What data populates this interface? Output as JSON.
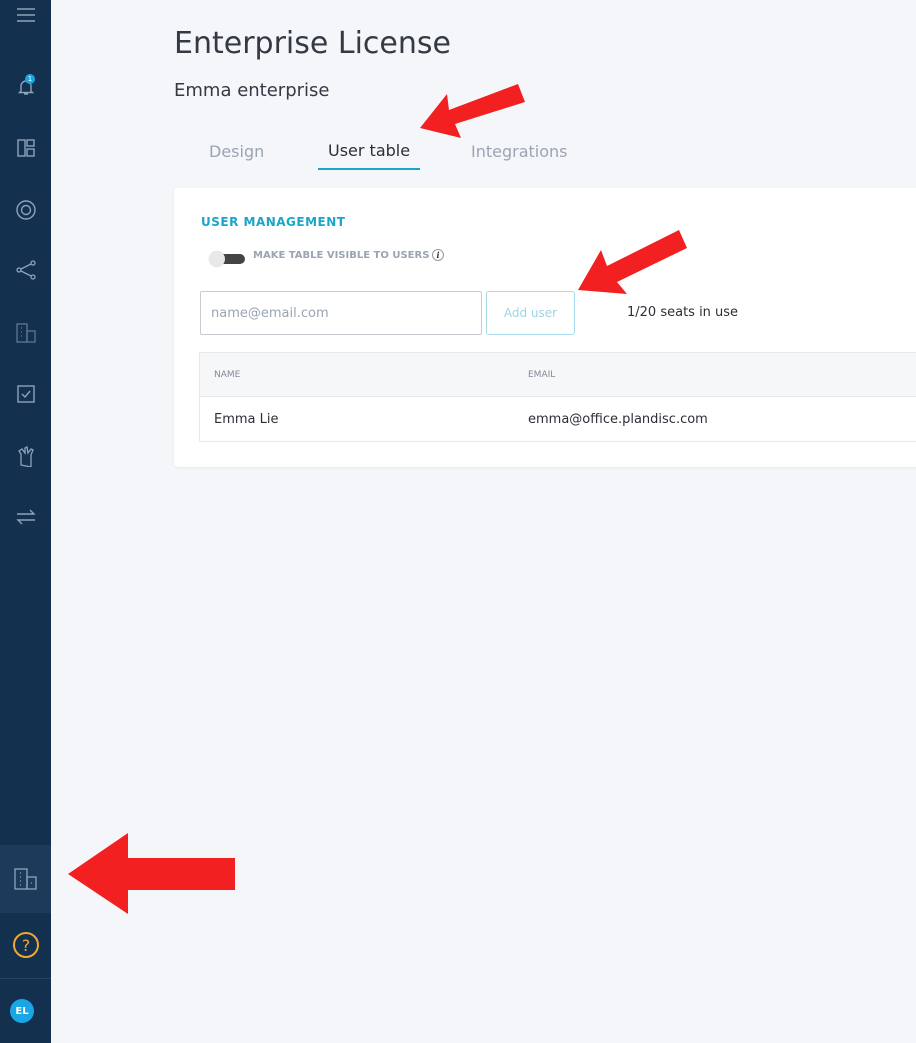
{
  "sidebar": {
    "notification_count": "1",
    "avatar_initials": "EL",
    "icons": [
      "menu-icon",
      "bell-icon",
      "dashboard-icon",
      "target-icon",
      "share-icon",
      "building-icon",
      "checkbox-icon",
      "hand-icon",
      "swap-icon",
      "building-icon",
      "help-icon"
    ]
  },
  "header": {
    "title": "Enterprise License",
    "subtitle": "Emma enterprise"
  },
  "tabs": [
    {
      "label": "Design",
      "active": false
    },
    {
      "label": "User table",
      "active": true
    },
    {
      "label": "Integrations",
      "active": false
    }
  ],
  "user_management": {
    "title": "USER MANAGEMENT",
    "toggle_label": "MAKE TABLE VISIBLE TO USERS",
    "toggle_on": false,
    "email_placeholder": "name@email.com",
    "add_user_label": "Add user",
    "seats_text": "1/20 seats in use"
  },
  "table": {
    "columns": [
      "NAME",
      "EMAIL"
    ],
    "rows": [
      {
        "name": "Emma Lie",
        "email": "emma@office.plandisc.com"
      }
    ]
  },
  "colors": {
    "sidebar_bg": "#13304f",
    "accent": "#1aa6c9",
    "arrow": "#f22020"
  }
}
